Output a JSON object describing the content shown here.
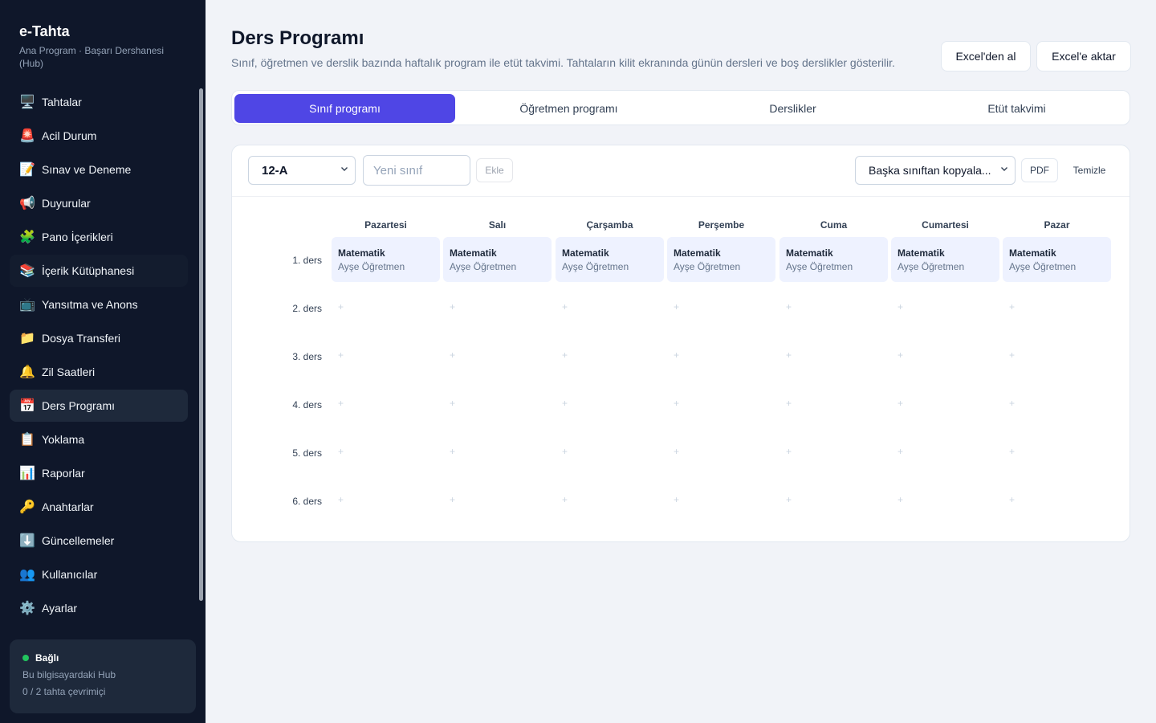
{
  "sidebar": {
    "app_title": "e-Tahta",
    "app_subtitle": "Ana Program · Başarı Dershanesi (Hub)",
    "items": [
      {
        "label": "Tahtalar",
        "icon": "🖥️",
        "name": "monitor-icon"
      },
      {
        "label": "Acil Durum",
        "icon": "🚨",
        "name": "siren-icon"
      },
      {
        "label": "Sınav ve Deneme",
        "icon": "📝",
        "name": "memo-icon"
      },
      {
        "label": "Duyurular",
        "icon": "📢",
        "name": "megaphone-icon"
      },
      {
        "label": "Pano İçerikleri",
        "icon": "🧩",
        "name": "puzzle-icon"
      },
      {
        "label": "İçerik Kütüphanesi",
        "icon": "📚",
        "name": "books-icon"
      },
      {
        "label": "Yansıtma ve Anons",
        "icon": "📺",
        "name": "tv-icon"
      },
      {
        "label": "Dosya Transferi",
        "icon": "📁",
        "name": "folder-icon"
      },
      {
        "label": "Zil Saatleri",
        "icon": "🔔",
        "name": "bell-icon"
      },
      {
        "label": "Ders Programı",
        "icon": "📅",
        "name": "calendar-icon"
      },
      {
        "label": "Yoklama",
        "icon": "📋",
        "name": "clipboard-icon"
      },
      {
        "label": "Raporlar",
        "icon": "📊",
        "name": "bar-chart-icon"
      },
      {
        "label": "Anahtarlar",
        "icon": "🔑",
        "name": "key-icon"
      },
      {
        "label": "Güncellemeler",
        "icon": "⬇️",
        "name": "download-icon"
      },
      {
        "label": "Kullanıcılar",
        "icon": "👥",
        "name": "users-icon"
      },
      {
        "label": "Ayarlar",
        "icon": "⚙️",
        "name": "gear-icon"
      }
    ],
    "status": {
      "title": "Bağlı",
      "line1": "Bu bilgisayardaki Hub",
      "line2": "0 / 2 tahta çevrimiçi",
      "color": "#22c55e"
    }
  },
  "header": {
    "title": "Ders Programı",
    "description": "Sınıf, öğretmen ve derslik bazında haftalık program ile etüt takvimi. Tahtaların kilit ekranında günün dersleri ve boş derslikler gösterilir.",
    "import_label": "Excel'den al",
    "export_label": "Excel'e aktar"
  },
  "tabs": [
    "Sınıf programı",
    "Öğretmen programı",
    "Derslikler",
    "Etüt takvimi"
  ],
  "toolbar": {
    "class_value": "12-A",
    "new_class_placeholder": "Yeni sınıf",
    "add_label": "Ekle",
    "copy_label": "Başka sınıftan kopyala...",
    "pdf_label": "PDF",
    "clear_label": "Temizle"
  },
  "schedule": {
    "days": [
      "Pazartesi",
      "Salı",
      "Çarşamba",
      "Perşembe",
      "Cuma",
      "Cumartesi",
      "Pazar"
    ],
    "periods": [
      "1. ders",
      "2. ders",
      "3. ders",
      "4. ders",
      "5. ders",
      "6. ders"
    ],
    "empty_symbol": "+",
    "first_row": [
      {
        "subject": "Matematik",
        "teacher": "Ayşe Öğretmen"
      },
      {
        "subject": "Matematik",
        "teacher": "Ayşe Öğretmen"
      },
      {
        "subject": "Matematik",
        "teacher": "Ayşe Öğretmen"
      },
      {
        "subject": "Matematik",
        "teacher": "Ayşe Öğretmen"
      },
      {
        "subject": "Matematik",
        "teacher": "Ayşe Öğretmen"
      },
      {
        "subject": "Matematik",
        "teacher": "Ayşe Öğretmen"
      },
      {
        "subject": "Matematik",
        "teacher": "Ayşe Öğretmen"
      }
    ]
  },
  "colors": {
    "sidebar_bg": "#0f172a",
    "accent": "#4f46e5",
    "cell_bg": "#eef2ff"
  }
}
